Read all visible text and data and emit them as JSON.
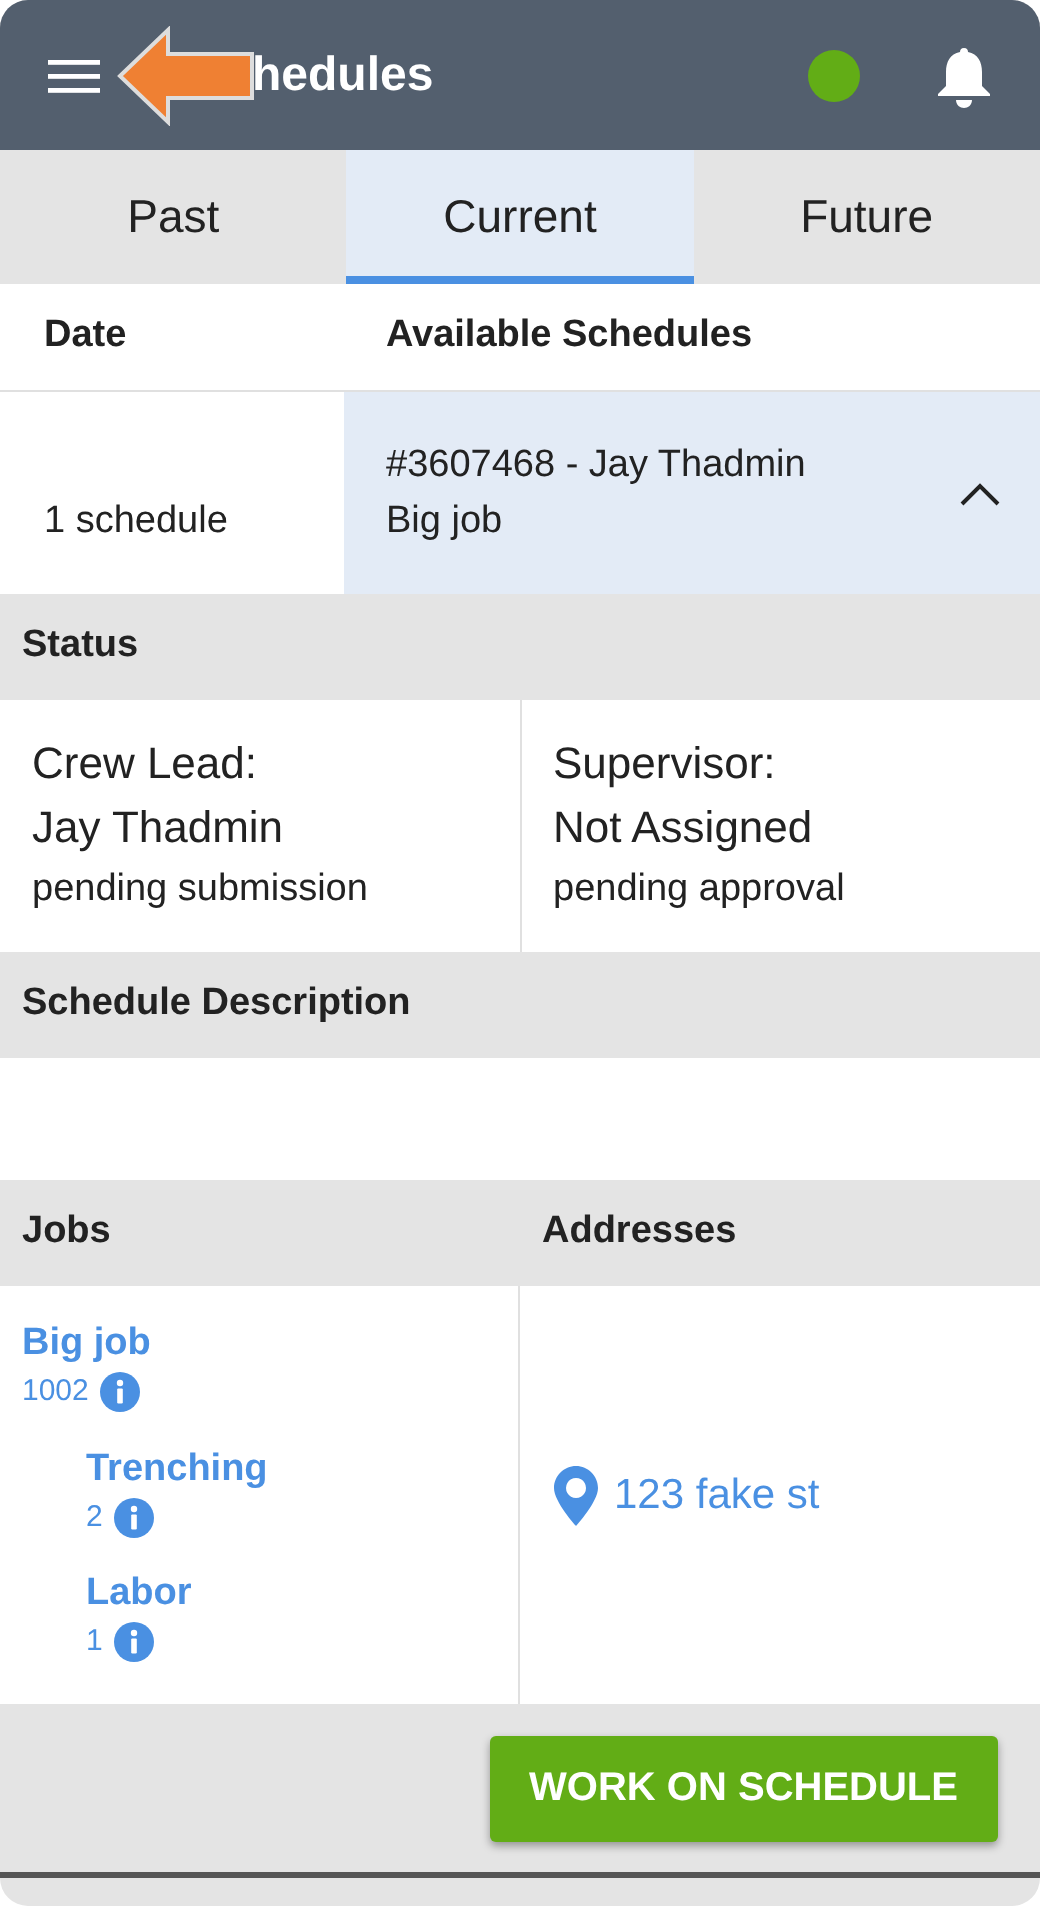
{
  "header": {
    "title_visible": "hedules",
    "online": true
  },
  "tabs": [
    {
      "label": "Past",
      "selected": false
    },
    {
      "label": "Current",
      "selected": true
    },
    {
      "label": "Future",
      "selected": false
    }
  ],
  "table": {
    "columns": [
      "Date",
      "Available Schedules"
    ],
    "rows": [
      {
        "date": "1 schedule",
        "title": "#3607468 - Jay Thadmin",
        "subtitle": "Big job",
        "expanded": true,
        "selected": true
      }
    ]
  },
  "status": {
    "heading": "Status",
    "crew_lead": {
      "label": "Crew Lead:",
      "name": "Jay Thadmin",
      "state": "pending submission"
    },
    "supervisor": {
      "label": "Supervisor:",
      "name": "Not Assigned",
      "state": "pending approval"
    }
  },
  "description": {
    "heading": "Schedule Description"
  },
  "jobs": {
    "columns": [
      "Jobs",
      "Addresses"
    ],
    "items": [
      {
        "name": "Big job",
        "number": "1002",
        "children": [
          {
            "name": "Trenching",
            "number": "2"
          },
          {
            "name": "Labor",
            "number": "1"
          }
        ]
      }
    ],
    "addresses": [
      "123 fake st"
    ]
  },
  "action_button": "WORK ON SCHEDULE"
}
